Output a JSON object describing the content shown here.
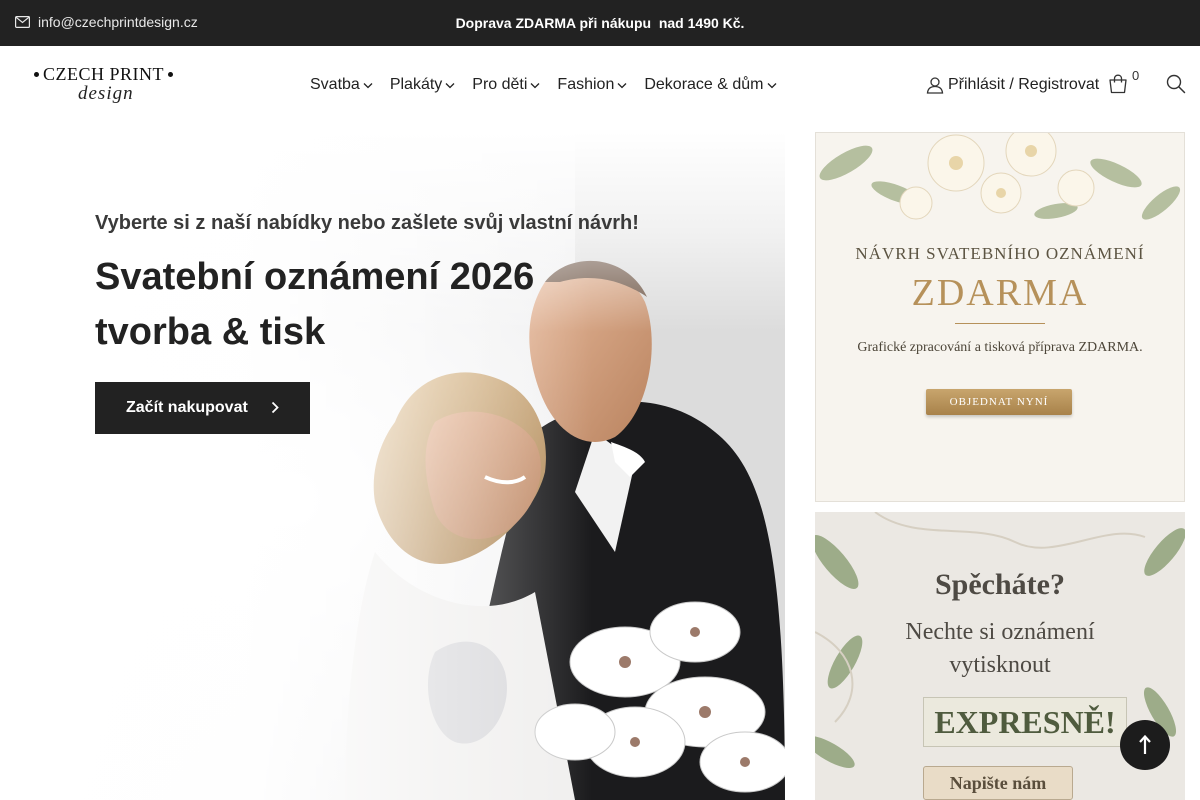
{
  "topbar": {
    "email": "info@czechprintdesign.cz",
    "promo": "Doprava ZDARMA při nákupu  nad 1490 Kč.",
    "icons": {
      "email": "mail-icon"
    }
  },
  "header": {
    "logo": {
      "line1": "CZECH PRINT",
      "line2": "design"
    },
    "nav": [
      {
        "label": "Svatba"
      },
      {
        "label": "Plakáty"
      },
      {
        "label": "Pro děti"
      },
      {
        "label": "Fashion"
      },
      {
        "label": "Dekorace & dům"
      }
    ],
    "account_label": "Přihlásit / Registrovat",
    "cart_count": "0",
    "icons": {
      "account": "user-icon",
      "cart": "shopping-bag-icon",
      "search": "search-icon"
    }
  },
  "hero": {
    "subtitle": "Vyberte si z naší nabídky nebo zašlete svůj vlastní návrh!",
    "title_line1": "Svatební oznámení 2026",
    "title_line2": "tvorba & tisk",
    "cta_label": "Začít nakupovat"
  },
  "banners": {
    "first": {
      "title": "NÁVRH SVATEBNÍHO OZNÁMENÍ",
      "big": "ZDARMA",
      "text": "Grafické zpracování a tisková příprava ZDARMA.",
      "button": "OBJEDNAT NYNÍ"
    },
    "second": {
      "title": "Spěcháte?",
      "text_line1": "Nechte si oznámení",
      "text_line2": "vytisknout",
      "big": "EXPRESNĚ!",
      "button": "Napište nám"
    }
  },
  "colors": {
    "topbar_bg": "#222222",
    "button_bg": "#222222",
    "gold": "#b6915a"
  }
}
